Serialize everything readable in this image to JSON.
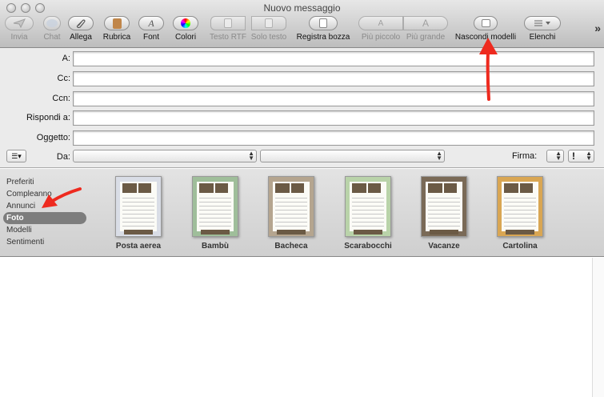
{
  "window": {
    "title": "Nuovo messaggio"
  },
  "toolbar": {
    "send": "Invia",
    "chat": "Chat",
    "attach": "Allega",
    "addressbook": "Rubrica",
    "font": "Font",
    "colors": "Colori",
    "rich_text": "Testo RTF",
    "plain_text": "Solo testo",
    "save_draft": "Registra bozza",
    "smaller": "Più piccolo",
    "bigger": "Più grande",
    "hide_templates": "Nascondi modelli",
    "lists": "Elenchi",
    "overflow": "»",
    "font_glyph": "A",
    "smaller_glyph": "A",
    "bigger_glyph": "A"
  },
  "fields": {
    "to": "A:",
    "cc": "Cc:",
    "bcc": "Ccn:",
    "reply_to": "Rispondi a:",
    "subject": "Oggetto:",
    "from": "Da:",
    "signature": "Firma:",
    "priority": "!",
    "account_menu": "☰▾"
  },
  "stationery": {
    "categories": [
      {
        "label": "Preferiti"
      },
      {
        "label": "Compleanno"
      },
      {
        "label": "Annunci"
      },
      {
        "label": "Foto",
        "selected": true
      },
      {
        "label": "Modelli"
      },
      {
        "label": "Sentimenti"
      }
    ],
    "templates": [
      {
        "name": "Posta aerea",
        "bg": "#d9dde6"
      },
      {
        "name": "Bambù",
        "bg": "#9fbe9a"
      },
      {
        "name": "Bacheca",
        "bg": "#b5a58f"
      },
      {
        "name": "Scarabocchi",
        "bg": "#b9d3a9"
      },
      {
        "name": "Vacanze",
        "bg": "#7a6a57"
      },
      {
        "name": "Cartolina",
        "bg": "#d9a653"
      }
    ]
  },
  "colors": {
    "annotation_arrow": "#ee2a1f",
    "selected_category": "#7d7d7d"
  }
}
